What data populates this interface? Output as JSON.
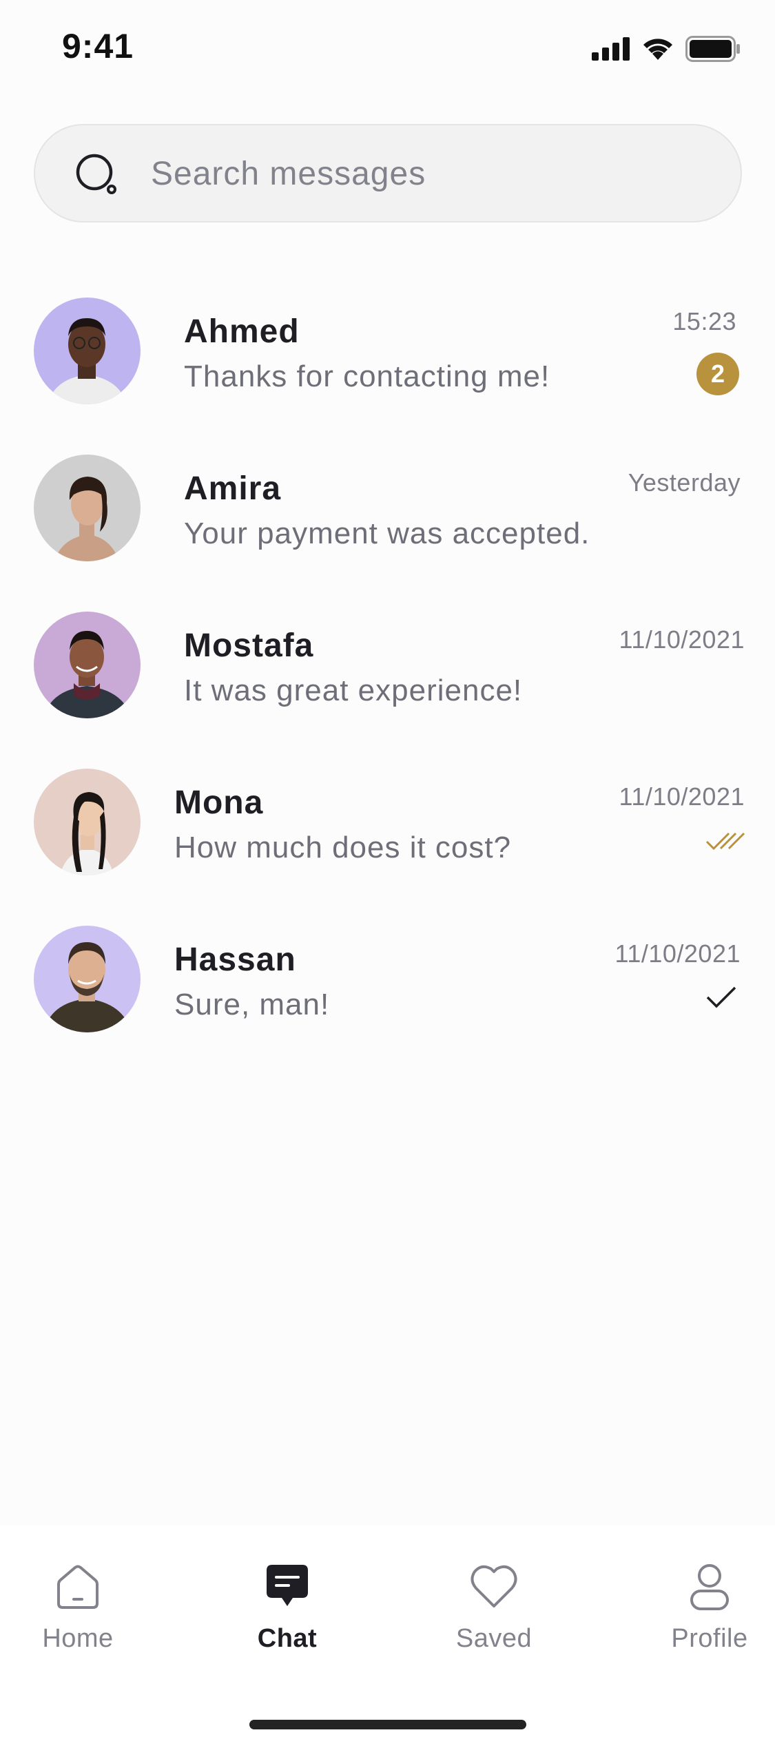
{
  "status_bar": {
    "time": "9:41"
  },
  "search": {
    "placeholder": "Search messages",
    "value": ""
  },
  "conversations": [
    {
      "name": "Ahmed",
      "message": "Thanks for contacting me!",
      "time": "15:23",
      "unread": "2",
      "status": "unread"
    },
    {
      "name": "Amira",
      "message": "Your payment was accepted.",
      "time": "Yesterday",
      "unread": "",
      "status": "none"
    },
    {
      "name": "Mostafa",
      "message": "It was great experience!",
      "time": "11/10/2021",
      "unread": "",
      "status": "none"
    },
    {
      "name": "Mona",
      "message": "How much does it cost?",
      "time": "11/10/2021",
      "unread": "",
      "status": "read-double-check-icon"
    },
    {
      "name": "Hassan",
      "message": "Sure, man!",
      "time": "11/10/2021",
      "unread": "",
      "status": "sent-check-icon"
    }
  ],
  "bottom_nav": {
    "items": [
      {
        "label": "Home",
        "icon": "home-icon",
        "active": false
      },
      {
        "label": "Chat",
        "icon": "chat-icon",
        "active": true
      },
      {
        "label": "Saved",
        "icon": "heart-icon",
        "active": false
      },
      {
        "label": "Profile",
        "icon": "profile-icon",
        "active": false
      }
    ]
  },
  "colors": {
    "accent": "#B9923D",
    "background": "#FCFCFC",
    "text_primary": "#1E1E24",
    "text_secondary": "#6E6E78",
    "avatar_purple": "#BEB4F0",
    "avatar_gray": "#CFCFCF",
    "avatar_mauve": "#C9A9D6",
    "avatar_beige": "#E5CFC6"
  }
}
